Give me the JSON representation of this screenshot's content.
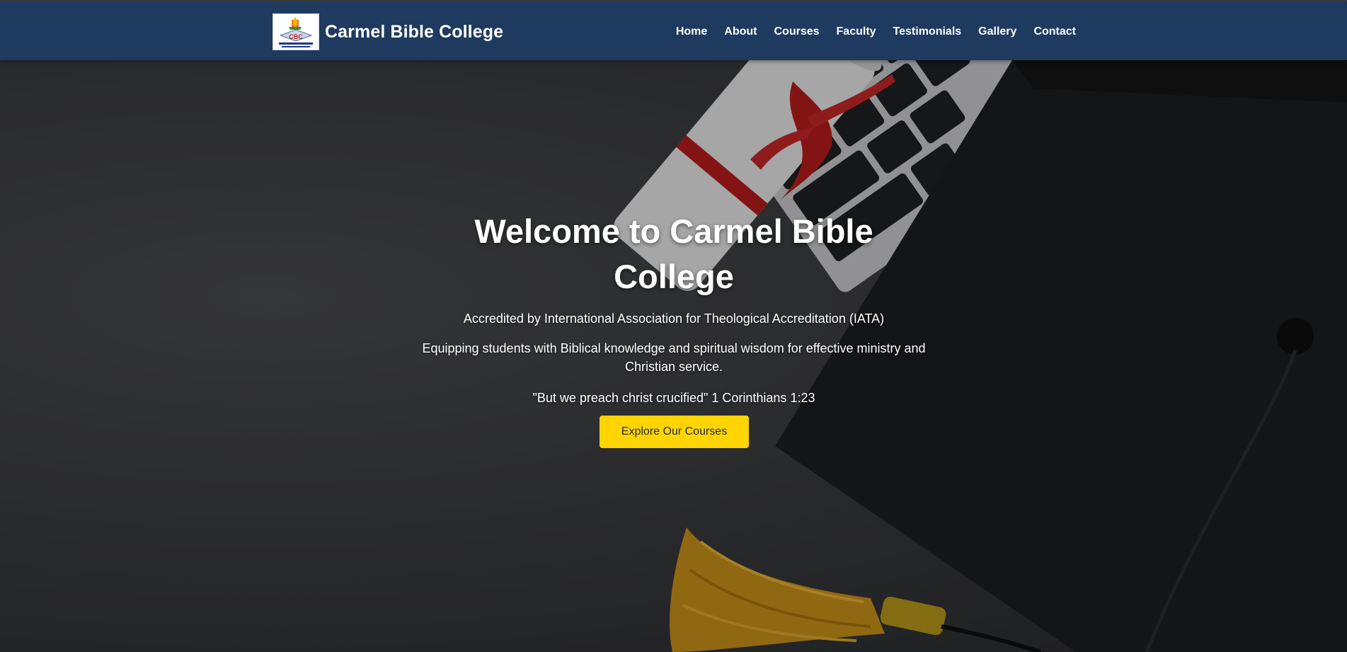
{
  "header": {
    "brand": "Carmel Bible College",
    "logo_icon": "college-crest-icon",
    "nav": [
      {
        "label": "Home"
      },
      {
        "label": "About"
      },
      {
        "label": "Courses"
      },
      {
        "label": "Faculty"
      },
      {
        "label": "Testimonials"
      },
      {
        "label": "Gallery"
      },
      {
        "label": "Contact"
      }
    ]
  },
  "hero": {
    "title": "Welcome to Carmel Bible College",
    "accreditation": "Accredited by International Association for Theological Accreditation (IATA)",
    "tagline": "Equipping students with Biblical knowledge and spiritual wisdom for effective ministry and Christian service.",
    "verse": "\"But we preach christ crucified\" 1 Corinthians 1:23",
    "cta_label": "Explore Our Courses",
    "background": "graduation-cap-diploma-keyboard-photo"
  },
  "colors": {
    "header_bg": "#1e3a5f",
    "accent": "#ffd400",
    "text": "#ffffff"
  }
}
